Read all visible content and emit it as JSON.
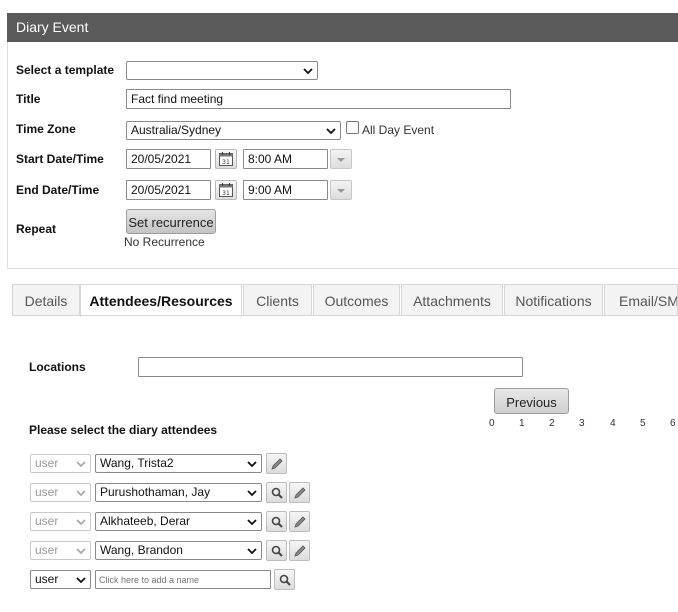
{
  "window": {
    "title": "Diary Event"
  },
  "form": {
    "template_label": "Select a template",
    "template_value": "",
    "title_label": "Title",
    "title_value": "Fact find meeting",
    "timezone_label": "Time Zone",
    "timezone_value": "Australia/Sydney",
    "all_day_label": "All Day Event",
    "all_day_checked": false,
    "start_label": "Start Date/Time",
    "start_date": "20/05/2021",
    "start_time": "8:00 AM",
    "end_label": "End Date/Time",
    "end_date": "20/05/2021",
    "end_time": "9:00 AM",
    "repeat_label": "Repeat",
    "recurrence_button": "Set recurrence",
    "recurrence_status": "No Recurrence"
  },
  "tabs": [
    {
      "label": "Details",
      "active": false
    },
    {
      "label": "Attendees/Resources",
      "active": true
    },
    {
      "label": "Clients",
      "active": false
    },
    {
      "label": "Outcomes",
      "active": false
    },
    {
      "label": "Attachments",
      "active": false
    },
    {
      "label": "Notifications",
      "active": false
    },
    {
      "label": "Email/SMS",
      "active": false
    }
  ],
  "attendees_panel": {
    "locations_label": "Locations",
    "locations_value": "",
    "previous_button": "Previous",
    "page_numbers": [
      "0",
      "1",
      "2",
      "3",
      "4",
      "5",
      "6"
    ],
    "heading": "Please select the diary attendees",
    "rows": [
      {
        "type": "user",
        "name": "Wang, Trista2"
      },
      {
        "type": "user",
        "name": "Purushothaman, Jay"
      },
      {
        "type": "user",
        "name": "Alkhateeb, Derar"
      },
      {
        "type": "user",
        "name": "Wang, Brandon"
      }
    ],
    "new_row": {
      "type": "user",
      "placeholder": "Click here to add a name"
    }
  },
  "colors": {
    "title_bar": "#5a5a5a",
    "tab_active_bg": "#ffffff",
    "tab_inactive_bg": "#f3f3f3"
  }
}
